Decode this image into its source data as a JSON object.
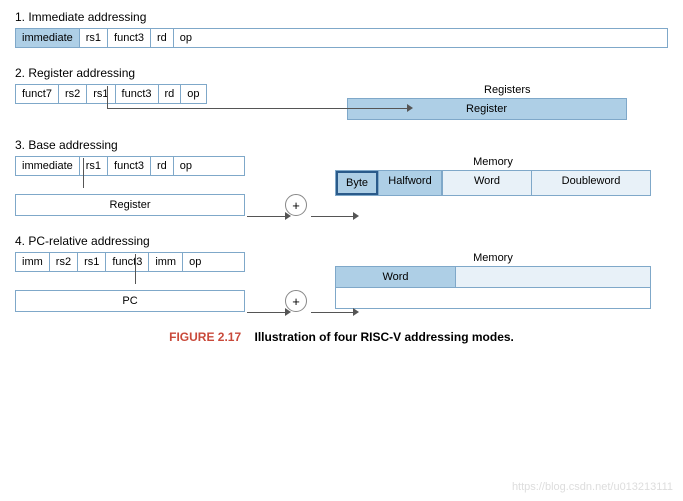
{
  "sections": {
    "s1": {
      "title": "1.  Immediate addressing",
      "fields": [
        "immediate",
        "rs1",
        "funct3",
        "rd",
        "op"
      ]
    },
    "s2": {
      "title": "2. Register addressing",
      "fields": [
        "funct7",
        "rs2",
        "rs1",
        "funct3",
        "rd",
        "op"
      ],
      "block_label": "Registers",
      "block_inner": "Register"
    },
    "s3": {
      "title": "3. Base addressing",
      "fields": [
        "immediate",
        "rs1",
        "funct3",
        "rd",
        "op"
      ],
      "reg": "Register",
      "plus": "+",
      "mem_label": "Memory",
      "mem": [
        "Byte",
        "Halfword",
        "Word",
        "Doubleword"
      ]
    },
    "s4": {
      "title": "4. PC-relative addressing",
      "fields": [
        "imm",
        "rs2",
        "rs1",
        "funct3",
        "imm",
        "op"
      ],
      "pc": "PC",
      "plus": "+",
      "mem_label": "Memory",
      "mem_word": "Word"
    }
  },
  "caption": {
    "fig": "FIGURE 2.17",
    "text": "Illustration of four RISC-V addressing modes."
  },
  "watermark": "https://blog.csdn.net/u013213111"
}
